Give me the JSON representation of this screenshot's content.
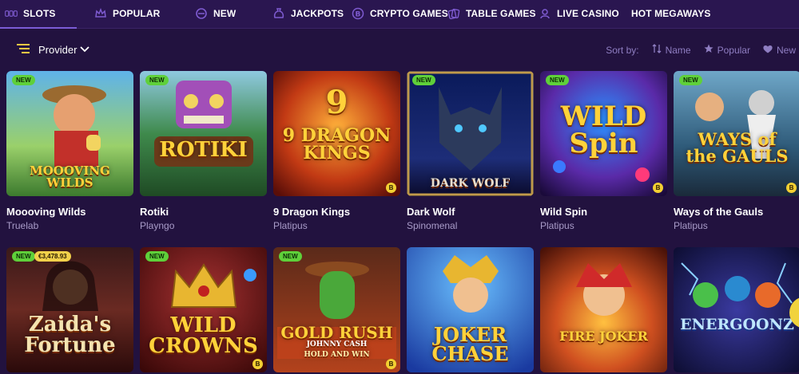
{
  "nav": {
    "items": [
      {
        "label": "SLOTS",
        "icon": "slot-machine-icon"
      },
      {
        "label": "POPULAR",
        "icon": "crown-icon"
      },
      {
        "label": "NEW",
        "icon": "new-badge-icon"
      },
      {
        "label": "JACKPOTS",
        "icon": "money-bag-icon"
      },
      {
        "label": "CRYPTO GAMES",
        "icon": "bitcoin-icon"
      },
      {
        "label": "TABLE GAMES",
        "icon": "cards-icon"
      },
      {
        "label": "LIVE CASINO",
        "icon": "live-dealer-icon"
      },
      {
        "label": "HOT MEGAWAYS",
        "icon": ""
      }
    ],
    "active": "SLOTS"
  },
  "filter": {
    "provider_label": "Provider",
    "sort_label": "Sort by:",
    "sort_options": [
      {
        "label": "Name",
        "icon": "sort-arrows-icon"
      },
      {
        "label": "Popular",
        "icon": "star-icon"
      },
      {
        "label": "New",
        "icon": "heart-icon"
      }
    ]
  },
  "games": [
    {
      "name": "Moooving Wilds",
      "provider": "Truelab",
      "badge": "NEW",
      "logo": "MOOOVING WILDS",
      "accent": "#3e7fd0"
    },
    {
      "name": "Rotiki",
      "provider": "Playngo",
      "badge": "NEW",
      "logo": "ROTIKI",
      "accent": "#3f8a4c"
    },
    {
      "name": "9 Dragon Kings",
      "provider": "Platipus",
      "badge": "",
      "logo": "9 DRAGON KINGS",
      "accent": "#c23a14",
      "b": true
    },
    {
      "name": "Dark Wolf",
      "provider": "Spinomenal",
      "badge": "NEW",
      "logo": "DARK WOLF",
      "accent": "#1d2d78"
    },
    {
      "name": "Wild Spin",
      "provider": "Platipus",
      "badge": "NEW",
      "logo": "WILD Spin",
      "accent": "#5a2aa8",
      "b": true
    },
    {
      "name": "Ways of the Gauls",
      "provider": "Platipus",
      "badge": "NEW",
      "logo": "WAYS of the GAULS",
      "accent": "#2f5b7a",
      "b": true
    },
    {
      "name": "",
      "provider": "",
      "badge": "NEW",
      "jackpot": "€3,478.93",
      "logo": "Zaida's Fortune",
      "accent": "#6a2a22"
    },
    {
      "name": "",
      "provider": "",
      "badge": "NEW",
      "logo": "WILD CROWNS",
      "accent": "#5a1214",
      "b": true
    },
    {
      "name": "",
      "provider": "",
      "badge": "NEW",
      "logo": "GOLD RUSH",
      "logo_sub": "JOHNNY CASH",
      "logo_sub2": "HOLD AND WIN",
      "accent": "#b3421c",
      "b": true
    },
    {
      "name": "",
      "provider": "",
      "badge": "",
      "logo": "JOKER CHASE",
      "accent": "#2a6ad0"
    },
    {
      "name": "",
      "provider": "",
      "badge": "",
      "logo": "FIRE JOKER",
      "accent": "#a8371c"
    },
    {
      "name": "",
      "provider": "",
      "badge": "",
      "logo": "ENERGOONZ",
      "accent": "#1e1e6a"
    }
  ]
}
